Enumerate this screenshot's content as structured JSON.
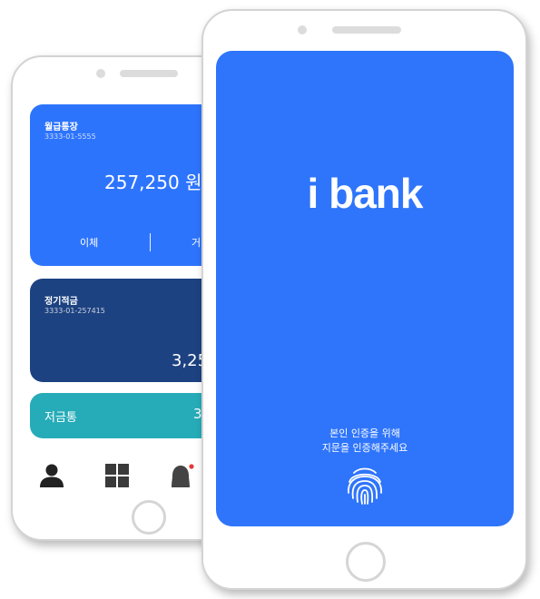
{
  "back_phone": {
    "checking_card": {
      "title": "월급통장",
      "account_number": "3333-01-5555",
      "balance": "257,250 원",
      "actions": [
        "이체",
        "거"
      ]
    },
    "savings_card": {
      "title": "정기적금",
      "account_number": "3333-01-257415",
      "balance": "3,25"
    },
    "piggy_card": {
      "title": "저금통",
      "balance": "3"
    },
    "bottom_nav": {
      "items": [
        "person-icon",
        "grid-icon",
        "bell-icon"
      ],
      "notification_color": "#e53935"
    }
  },
  "front_phone": {
    "logo": "i bank",
    "auth_line1": "본인 인증을 위해",
    "auth_line2": "지문을 인증해주세요",
    "icon": "fingerprint-icon"
  },
  "colors": {
    "primary_blue": "#2f75fb",
    "navy": "#1d4281",
    "teal": "#26acb8"
  }
}
